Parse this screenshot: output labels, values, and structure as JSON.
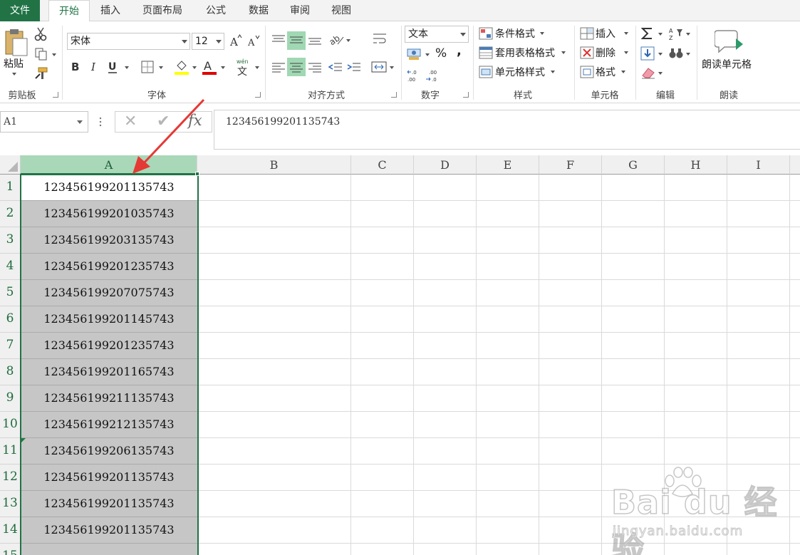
{
  "tabs": {
    "file": "文件",
    "items": [
      "开始",
      "插入",
      "页面布局",
      "公式",
      "数据",
      "审阅",
      "视图"
    ],
    "active": "开始"
  },
  "ribbon": {
    "clipboard": {
      "label": "剪贴板",
      "paste": "粘贴"
    },
    "font": {
      "label": "字体",
      "name": "宋体",
      "size": "12",
      "phonetic_glyph": "wén\n文"
    },
    "alignment": {
      "label": "对齐方式"
    },
    "number": {
      "label": "数字",
      "format": "文本",
      "percent": "%",
      "comma": ",",
      "inc_dec_top": ".0",
      "inc_dec_bottom": ".00"
    },
    "styles": {
      "label": "样式",
      "conditional": "条件格式",
      "table": "套用表格格式",
      "cell": "单元格样式"
    },
    "cells": {
      "label": "单元格",
      "insert": "插入",
      "delete": "删除",
      "format": "格式"
    },
    "editing": {
      "label": "编辑"
    },
    "read": {
      "label": "朗读",
      "button": "朗读单元格"
    }
  },
  "formula_bar": {
    "name_box": "A1",
    "cancel": "✕",
    "enter": "✔",
    "fx": "fx",
    "value": "123456199201135743"
  },
  "grid": {
    "columns": [
      "A",
      "B",
      "C",
      "D",
      "E",
      "F",
      "G",
      "H",
      "I"
    ],
    "rows": [
      {
        "n": "1",
        "a": "123456199201135743"
      },
      {
        "n": "2",
        "a": "123456199201035743"
      },
      {
        "n": "3",
        "a": "123456199203135743"
      },
      {
        "n": "4",
        "a": "123456199201235743"
      },
      {
        "n": "5",
        "a": "123456199207075743"
      },
      {
        "n": "6",
        "a": "123456199201145743"
      },
      {
        "n": "7",
        "a": "123456199201235743"
      },
      {
        "n": "8",
        "a": "123456199201165743"
      },
      {
        "n": "9",
        "a": "123456199211135743"
      },
      {
        "n": "10",
        "a": "123456199212135743"
      },
      {
        "n": "11",
        "a": "123456199206135743"
      },
      {
        "n": "12",
        "a": "123456199201135743"
      },
      {
        "n": "13",
        "a": "123456199201135743"
      },
      {
        "n": "14",
        "a": "123456199201135743"
      },
      {
        "n": "15",
        "a": ""
      }
    ]
  },
  "watermark": {
    "brand": "Bai du 经验",
    "url": "jingyan.baidu.com"
  },
  "colors": {
    "accent": "#217346",
    "selection": "#c6c6c6",
    "annotation_arrow": "#e53935"
  }
}
